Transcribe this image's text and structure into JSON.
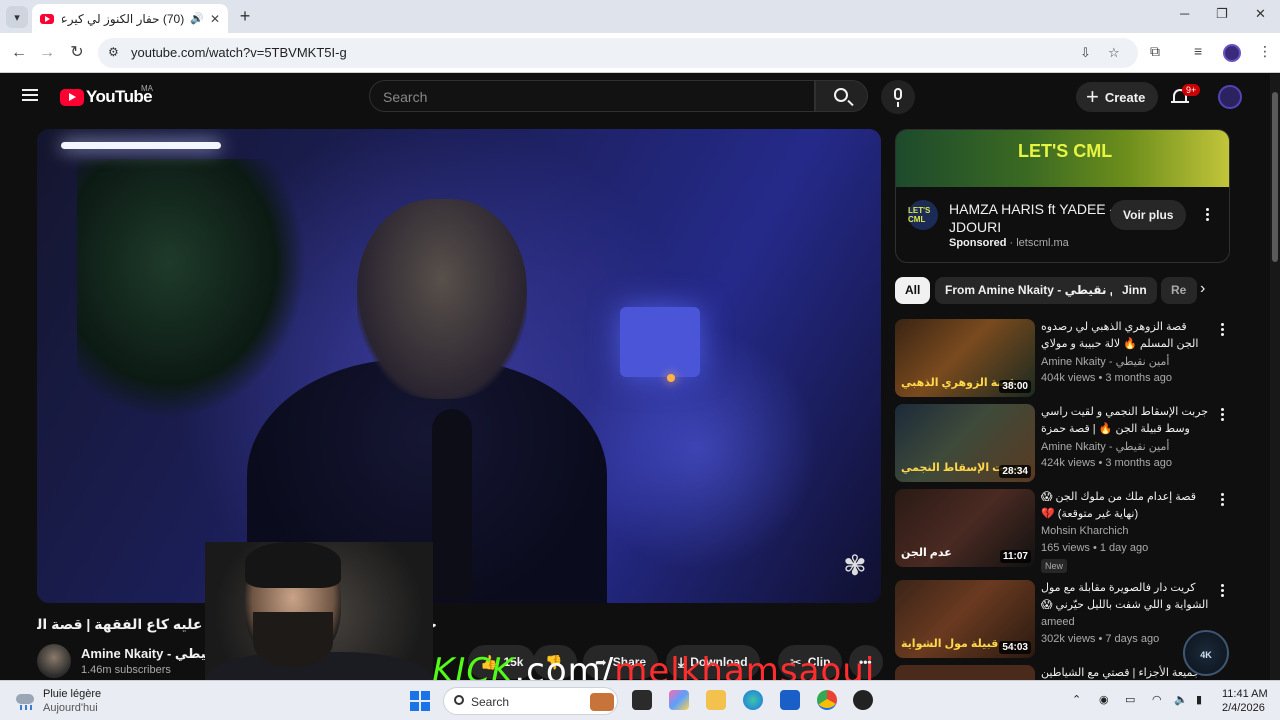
{
  "browser": {
    "tab_title": "(70) حفار الكنوز لي كيرعب الـ",
    "url": "youtube.com/watch?v=5TBVMKT5I-g",
    "new_tab": "+",
    "controls": {
      "minimize": "─",
      "maximize": "❐",
      "close": "✕"
    }
  },
  "youtube": {
    "logo_text": "YouTube",
    "logo_sup": "MA",
    "search_placeholder": "Search",
    "create_label": "Create",
    "notification_count": "9+"
  },
  "video": {
    "title": "حفار الكنوز لي كيرعب الـ... كيقلبو عليه كاع الفقهة | قصة السوباعي",
    "channel_name": "Amine Nkaity - أمين نقيطي",
    "subscribers": "1.46m subscribers",
    "actions": {
      "likes": "15k",
      "share": "Share",
      "download": "Download",
      "clip": "Clip"
    }
  },
  "overlay": {
    "kick_part1": "KICK",
    "kick_part2": ".com/",
    "kick_part3": "melkhamsaoui"
  },
  "ad": {
    "banner_text": "LET'S CML",
    "logo_text": "LET'S CML",
    "title": "HAMZA HARIS ft YADEE - JDOURI",
    "sponsored_label": "Sponsored",
    "domain": "letscml.ma",
    "cta": "Voir plus"
  },
  "chips": [
    "All",
    "From Amine Nkaity - أمين نقيطي",
    "Jinn",
    "Re"
  ],
  "recommendations": [
    {
      "title": "قصة الزوهري الذهبي لي رصدوه الجن المسلم 🔥 لالة حبيبة و مولاي بوعزة",
      "channel": "Amine Nkaity - أمين نقيطي",
      "stats": "404k views • 3 months ago",
      "duration": "38:00",
      "thumb_caption": "قصة الزوهري الذهبي",
      "badge": ""
    },
    {
      "title": "جربت الإسقاط النجمي و لقيت راسي وسط قبيلة الجن 🔥 | قصة حمزة",
      "channel": "Amine Nkaity - أمين نقيطي",
      "stats": "424k views • 3 months ago",
      "duration": "28:34",
      "thumb_caption": "جربت الإسقاط النجمي",
      "badge": ""
    },
    {
      "title": "قصة إعدام ملك من ملوك الجن 😱 (نهاية غير متوقعة) 💔",
      "channel": "Mohsin Kharchich",
      "stats": "165 views • 1 day ago",
      "duration": "11:07",
      "thumb_caption": "عدم الجن",
      "badge": "New"
    },
    {
      "title": "كريت دار فالصويرة مقابلة مع مول الشواية و اللي شفت بالليل حيّرني 😱 🔥 (قصة ...",
      "channel": "ameed",
      "stats": "302k views • 7 days ago",
      "duration": "54:03",
      "thumb_caption": "قبيلة مول الشواية",
      "badge": ""
    },
    {
      "title": "جميعة الأجزاء | قصتي مع الشياطين الأسود",
      "channel": "",
      "stats": "",
      "duration": "",
      "thumb_caption": "",
      "badge": ""
    }
  ],
  "corner_logo": "4K",
  "taskbar": {
    "weather_line1": "Pluie légère",
    "weather_line2": "Aujourd'hui",
    "search_label": "Search",
    "time": "11:41 AM",
    "date": "2/4/2026"
  }
}
